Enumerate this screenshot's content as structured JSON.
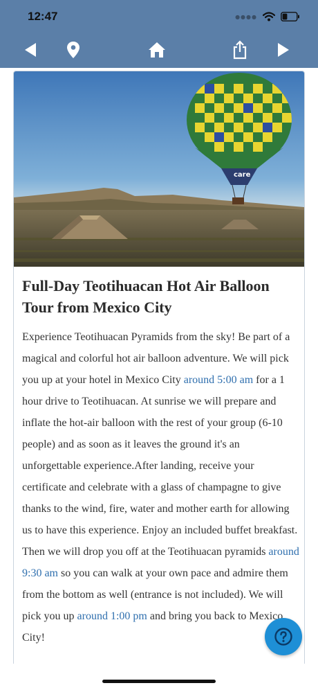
{
  "status_bar": {
    "time": "12:47",
    "signal_icon": "cellular-dots-icon",
    "wifi_icon": "wifi-icon",
    "battery_icon": "battery-icon",
    "battery_level": 0.35
  },
  "toolbar": {
    "icons": [
      "back-arrow-icon",
      "location-pin-icon",
      "home-icon",
      "share-icon",
      "forward-arrow-icon"
    ],
    "background": "#5b7fa8"
  },
  "hero_image": {
    "alt_description_hidden": "",
    "balloon_text": "care"
  },
  "tour": {
    "title": "Full-Day Teotihuacan Hot Air Balloon Tour from Mexico City",
    "description": {
      "p1": "Experience Teotihuacan Pyramids from the sky! Be part of a magical and colorful hot air balloon adventure. We will pick you up at your hotel in Mexico City ",
      "time1": "around 5:00 am",
      "p2": " for a 1 hour drive to Teotihuacan. At sunrise we will prepare and inflate the hot-air balloon with the rest of your group (6-10 people) and as soon as it leaves the ground it's an unforgettable experience.After landing, receive your certificate and celebrate with a glass of champagne to give thanks to the wind, fire, water and mother earth for allowing us to have this experience. Enjoy an included buffet breakfast. Then we will drop you off at the Teotihuacan pyramids ",
      "time2": "around 9:30 am",
      "p3": " so you can walk at your own pace and admire them from the bottom as well (entrance is not included). We will pick you up ",
      "time3": "around 1:00 pm",
      "p4": " and bring you back to Mexico City!"
    },
    "highlight_color": "#2f6fae"
  },
  "help": {
    "icon": "help-question-icon",
    "color": "#1e8fd6"
  }
}
